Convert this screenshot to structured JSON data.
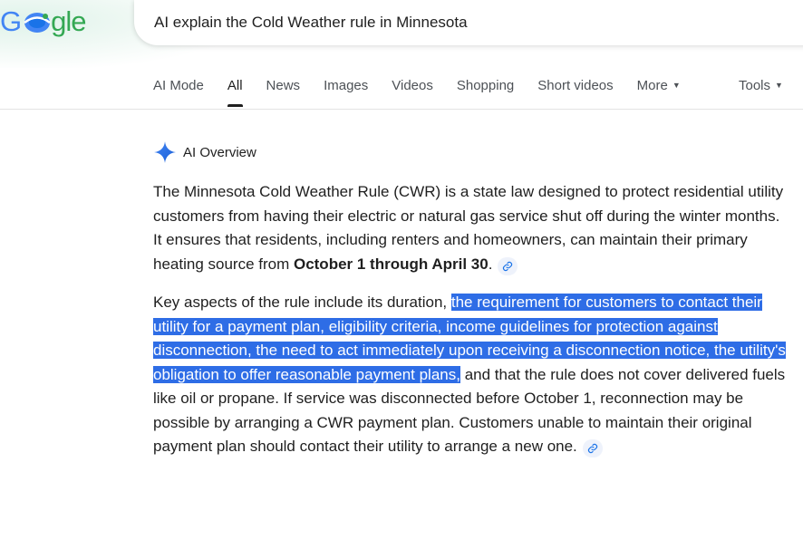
{
  "search": {
    "logo_text_prefix": "G",
    "logo_text_suffix": "gle",
    "query": "AI explain the Cold Weather rule in Minnesota"
  },
  "tabs": [
    {
      "label": "AI Mode"
    },
    {
      "label": "All",
      "active": true
    },
    {
      "label": "News"
    },
    {
      "label": "Images"
    },
    {
      "label": "Videos"
    },
    {
      "label": "Shopping"
    },
    {
      "label": "Short videos"
    },
    {
      "label": "More"
    }
  ],
  "tools_label": "Tools",
  "ai_overview": {
    "title": "AI Overview",
    "p1_text": "The Minnesota Cold Weather Rule (CWR) is a state law designed to protect residential utility customers from having their electric or natural gas service shut off during the winter months. It ensures that residents, including renters and homeowners, can maintain their primary heating source from ",
    "p1_bold": "October 1 through April 30",
    "p1_end": ".",
    "p2_start": "Key aspects of the rule include its duration, ",
    "p2_highlight": "the requirement for customers to contact their utility for a payment plan, eligibility criteria, income guidelines for protection against disconnection, the need to act immediately upon receiving a disconnection notice, the utility's obligation to offer reasonable payment plans,",
    "p2_end": " and that the rule does not cover delivered fuels like oil or propane. If service was disconnected before October 1, reconnection may be possible by arranging a CWR payment plan. Customers unable to maintain their original payment plan should contact their utility to arrange a new one.",
    "highlight_color": "#2e6de6"
  }
}
